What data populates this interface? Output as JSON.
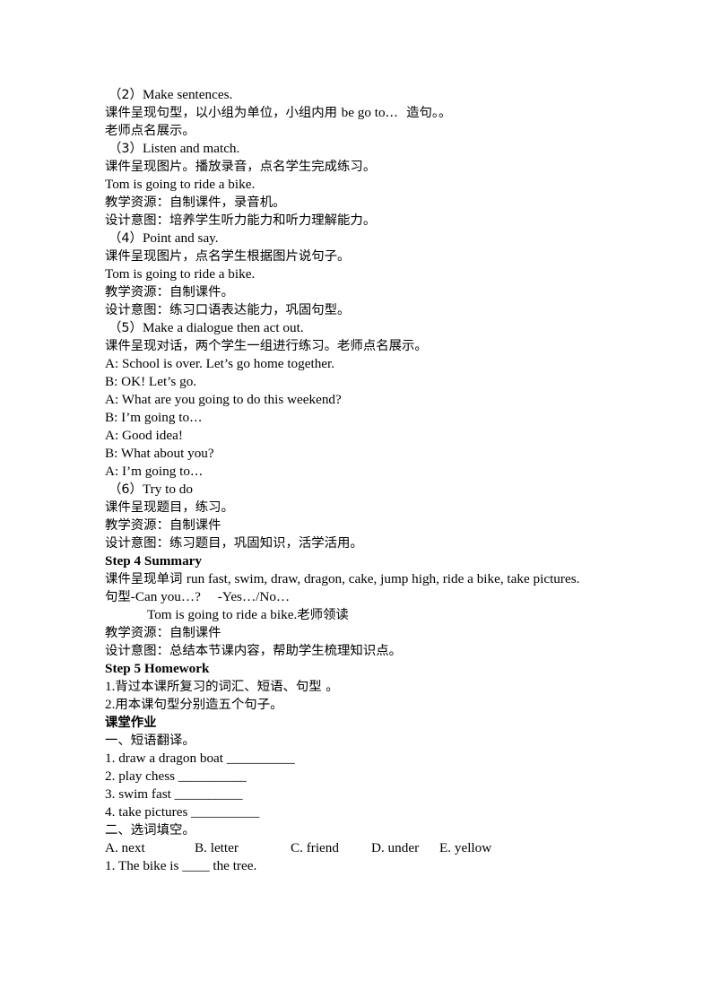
{
  "document": {
    "page_background": "#ffffff",
    "text_color": "#000000",
    "lines": [
      {
        "id": "l01",
        "indent": "par",
        "runs": [
          {
            "t": "cn",
            "s": "（2）"
          },
          {
            "t": "en",
            "s": "Make sentences."
          }
        ]
      },
      {
        "id": "l02",
        "indent": "none",
        "runs": [
          {
            "t": "cn",
            "s": "课件呈现句型，以小组为单位，小组内用 "
          },
          {
            "t": "en",
            "s": "be go to"
          },
          {
            "t": "cn",
            "s": "…  造句。。"
          }
        ]
      },
      {
        "id": "l03",
        "indent": "none",
        "runs": [
          {
            "t": "cn",
            "s": "老师点名展示。"
          }
        ]
      },
      {
        "id": "l04",
        "indent": "par",
        "runs": [
          {
            "t": "cn",
            "s": "（3）"
          },
          {
            "t": "en",
            "s": "Listen and match."
          }
        ]
      },
      {
        "id": "l05",
        "indent": "none",
        "runs": [
          {
            "t": "cn",
            "s": "课件呈现图片。播放录音，点名学生完成练习。"
          }
        ]
      },
      {
        "id": "l06",
        "indent": "none",
        "runs": [
          {
            "t": "en",
            "s": "Tom is going to ride a bike."
          }
        ]
      },
      {
        "id": "l07",
        "indent": "none",
        "runs": [
          {
            "t": "cn",
            "s": "教学资源：自制课件，录音机。"
          }
        ]
      },
      {
        "id": "l08",
        "indent": "none",
        "runs": [
          {
            "t": "cn",
            "s": "设计意图：培养学生听力能力和听力理解能力。"
          }
        ]
      },
      {
        "id": "l09",
        "indent": "par",
        "runs": [
          {
            "t": "cn",
            "s": "（4）"
          },
          {
            "t": "en",
            "s": "Point and say."
          }
        ]
      },
      {
        "id": "l10",
        "indent": "none",
        "runs": [
          {
            "t": "cn",
            "s": "课件呈现图片，点名学生根据图片说句子。"
          }
        ]
      },
      {
        "id": "l11",
        "indent": "none",
        "runs": [
          {
            "t": "en",
            "s": "Tom is going to ride a bike."
          }
        ]
      },
      {
        "id": "l12",
        "indent": "none",
        "runs": [
          {
            "t": "cn",
            "s": "教学资源：自制课件。"
          }
        ]
      },
      {
        "id": "l13",
        "indent": "none",
        "runs": [
          {
            "t": "cn",
            "s": "设计意图：练习口语表达能力，巩固句型。"
          }
        ]
      },
      {
        "id": "l14",
        "indent": "par",
        "runs": [
          {
            "t": "cn",
            "s": "（5）"
          },
          {
            "t": "en",
            "s": "Make a dialogue then act out."
          }
        ]
      },
      {
        "id": "l15",
        "indent": "none",
        "runs": [
          {
            "t": "cn",
            "s": "课件呈现对话，两个学生一组进行练习。老师点名展示。"
          }
        ]
      },
      {
        "id": "l16",
        "indent": "none",
        "runs": [
          {
            "t": "en",
            "s": "A: School is over. Let’s go home together."
          }
        ]
      },
      {
        "id": "l17",
        "indent": "none",
        "runs": [
          {
            "t": "en",
            "s": "B: OK! Let’s go."
          }
        ]
      },
      {
        "id": "l18",
        "indent": "none",
        "runs": [
          {
            "t": "en",
            "s": "A: What are you going to do this weekend?"
          }
        ]
      },
      {
        "id": "l19",
        "indent": "none",
        "runs": [
          {
            "t": "en",
            "s": "B: I’m going to"
          },
          {
            "t": "cn",
            "s": "…"
          }
        ]
      },
      {
        "id": "l20",
        "indent": "none",
        "runs": [
          {
            "t": "en",
            "s": "A: Good idea!"
          }
        ]
      },
      {
        "id": "l21",
        "indent": "none",
        "runs": [
          {
            "t": "en",
            "s": "B: What about you?"
          }
        ]
      },
      {
        "id": "l22",
        "indent": "none",
        "runs": [
          {
            "t": "en",
            "s": "A: I’m going to"
          },
          {
            "t": "cn",
            "s": "…"
          }
        ]
      },
      {
        "id": "l23",
        "indent": "par",
        "runs": [
          {
            "t": "cn",
            "s": "（6）"
          },
          {
            "t": "en",
            "s": "Try to do"
          }
        ]
      },
      {
        "id": "l24",
        "indent": "none",
        "runs": [
          {
            "t": "cn",
            "s": "课件呈现题目，练习。"
          }
        ]
      },
      {
        "id": "l25",
        "indent": "none",
        "runs": [
          {
            "t": "cn",
            "s": "教学资源：自制课件"
          }
        ]
      },
      {
        "id": "l26",
        "indent": "none",
        "runs": [
          {
            "t": "cn",
            "s": "设计意图：练习题目，巩固知识，活学活用。"
          }
        ]
      },
      {
        "id": "l27",
        "indent": "none",
        "runs": [
          {
            "t": "en",
            "s": "Step 4 Summary",
            "b": true
          }
        ]
      },
      {
        "id": "l28",
        "indent": "none",
        "runs": [
          {
            "t": "cn",
            "s": "课件呈现单词 "
          },
          {
            "t": "en",
            "s": "run fast, swim, draw, dragon, cake, jump high, ride a bike, take pictures."
          }
        ]
      },
      {
        "id": "l29",
        "indent": "none",
        "runs": [
          {
            "t": "cn",
            "s": "句型"
          },
          {
            "t": "en",
            "s": "-Can you…?     -Yes…/No…"
          }
        ]
      },
      {
        "id": "l30",
        "indent": "deep",
        "runs": [
          {
            "t": "en",
            "s": "Tom is going to ride a bike."
          },
          {
            "t": "cn",
            "s": "老师领读"
          }
        ]
      },
      {
        "id": "l31",
        "indent": "none",
        "runs": [
          {
            "t": "cn",
            "s": "教学资源：自制课件"
          }
        ]
      },
      {
        "id": "l32",
        "indent": "none",
        "runs": [
          {
            "t": "cn",
            "s": "设计意图：总结本节课内容，帮助学生梳理知识点。"
          }
        ]
      },
      {
        "id": "l33",
        "indent": "none",
        "runs": [
          {
            "t": "en",
            "s": "Step 5 Homework",
            "b": true
          }
        ]
      },
      {
        "id": "l34",
        "indent": "none",
        "runs": [
          {
            "t": "en",
            "s": "1."
          },
          {
            "t": "cn",
            "s": "背过本课所复习的词汇、短语、句型 。"
          }
        ]
      },
      {
        "id": "l35",
        "indent": "none",
        "runs": [
          {
            "t": "en",
            "s": "2."
          },
          {
            "t": "cn",
            "s": "用本课句型分别造五个句子。"
          }
        ]
      },
      {
        "id": "l36",
        "indent": "none",
        "runs": [
          {
            "t": "cn",
            "s": "课堂作业",
            "b": true
          }
        ]
      },
      {
        "id": "l37",
        "indent": "none",
        "runs": [
          {
            "t": "cn",
            "s": "一、短语翻译。"
          }
        ]
      },
      {
        "id": "l38",
        "indent": "none",
        "runs": [
          {
            "t": "en",
            "s": "1. draw a dragon boat __________"
          }
        ]
      },
      {
        "id": "l39",
        "indent": "none",
        "runs": [
          {
            "t": "en",
            "s": "2. play chess __________"
          }
        ]
      },
      {
        "id": "l40",
        "indent": "none",
        "runs": [
          {
            "t": "en",
            "s": "3. swim fast __________"
          }
        ]
      },
      {
        "id": "l41",
        "indent": "none",
        "runs": [
          {
            "t": "en",
            "s": "4. take pictures __________"
          }
        ]
      },
      {
        "id": "l42",
        "indent": "none",
        "runs": [
          {
            "t": "cn",
            "s": "二、选词填空。"
          }
        ]
      },
      {
        "id": "l43",
        "indent": "none",
        "options": [
          "A. next",
          "B. letter",
          "C. friend",
          "D. under",
          "E. yellow"
        ]
      },
      {
        "id": "l44",
        "indent": "none",
        "runs": [
          {
            "t": "en",
            "s": "1. The bike is ____ the tree."
          }
        ]
      }
    ]
  }
}
